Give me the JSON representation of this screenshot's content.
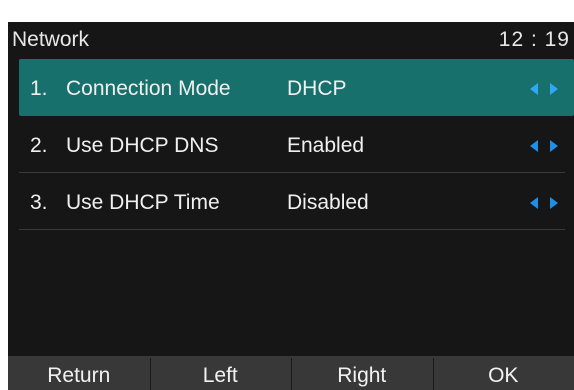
{
  "header": {
    "title": "Network",
    "time": "12 : 19"
  },
  "menu": {
    "items": [
      {
        "num": "1.",
        "label": "Connection Mode",
        "value": "DHCP",
        "selected": true,
        "arrow_icon": "left-right-arrows-icon"
      },
      {
        "num": "2.",
        "label": "Use DHCP DNS",
        "value": "Enabled",
        "selected": false,
        "arrow_icon": "left-right-arrows-icon"
      },
      {
        "num": "3.",
        "label": "Use DHCP Time",
        "value": "Disabled",
        "selected": false,
        "arrow_icon": "left-right-arrows-icon"
      }
    ]
  },
  "softkeys": {
    "return": "Return",
    "left": "Left",
    "right": "Right",
    "ok": "OK"
  },
  "colors": {
    "background": "#161616",
    "selection": "#17706c",
    "softkey_bar": "#383838",
    "arrow_selected": "#2fa7f5",
    "arrow": "#1e8fe8",
    "text": "#f0f0f0"
  }
}
